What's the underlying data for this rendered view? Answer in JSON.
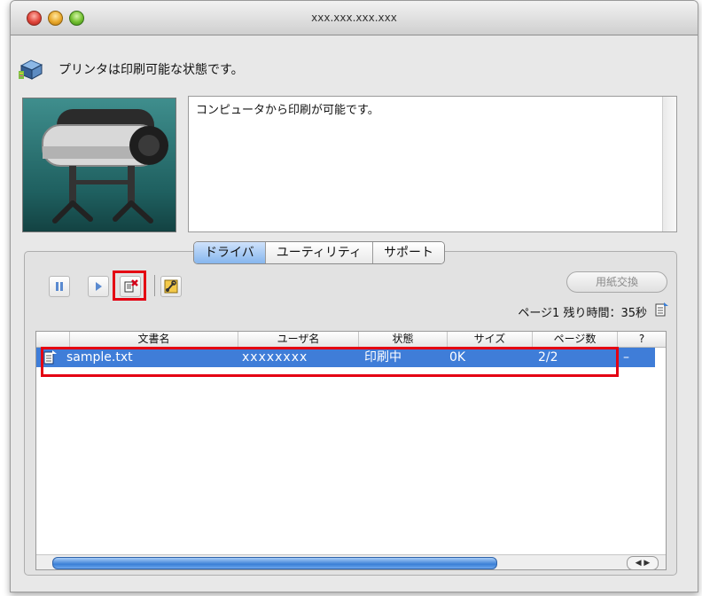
{
  "window": {
    "title": "xxx.xxx.xxx.xxx"
  },
  "status": {
    "text": "プリンタは印刷可能な状態です。",
    "icon": "printer-status-icon"
  },
  "message": {
    "text": "コンピュータから印刷が可能です。"
  },
  "tabs": [
    {
      "label": "ドライバ",
      "active": true
    },
    {
      "label": "ユーティリティ",
      "active": false
    },
    {
      "label": "サポート",
      "active": false
    }
  ],
  "toolbar": {
    "pause_icon": "pause-icon",
    "resume_icon": "play-icon",
    "delete_icon": "delete-job-icon",
    "utility_icon": "tool-icon",
    "paper_change_label": "用紙交換"
  },
  "page_info": {
    "text": "ページ1 残り時間：35秒"
  },
  "queue": {
    "columns": [
      "文書名",
      "ユーザ名",
      "状態",
      "サイズ",
      "ページ数",
      "?"
    ],
    "rows": [
      {
        "doc": "sample.txt",
        "user": "xxxxxxxx",
        "status": "印刷中",
        "size": "0K",
        "pages": "2/2",
        "extra": "–"
      }
    ]
  },
  "colors": {
    "selection": "#3f7dd8",
    "highlight": "#e40012",
    "tab_active": "#86b6ee"
  }
}
